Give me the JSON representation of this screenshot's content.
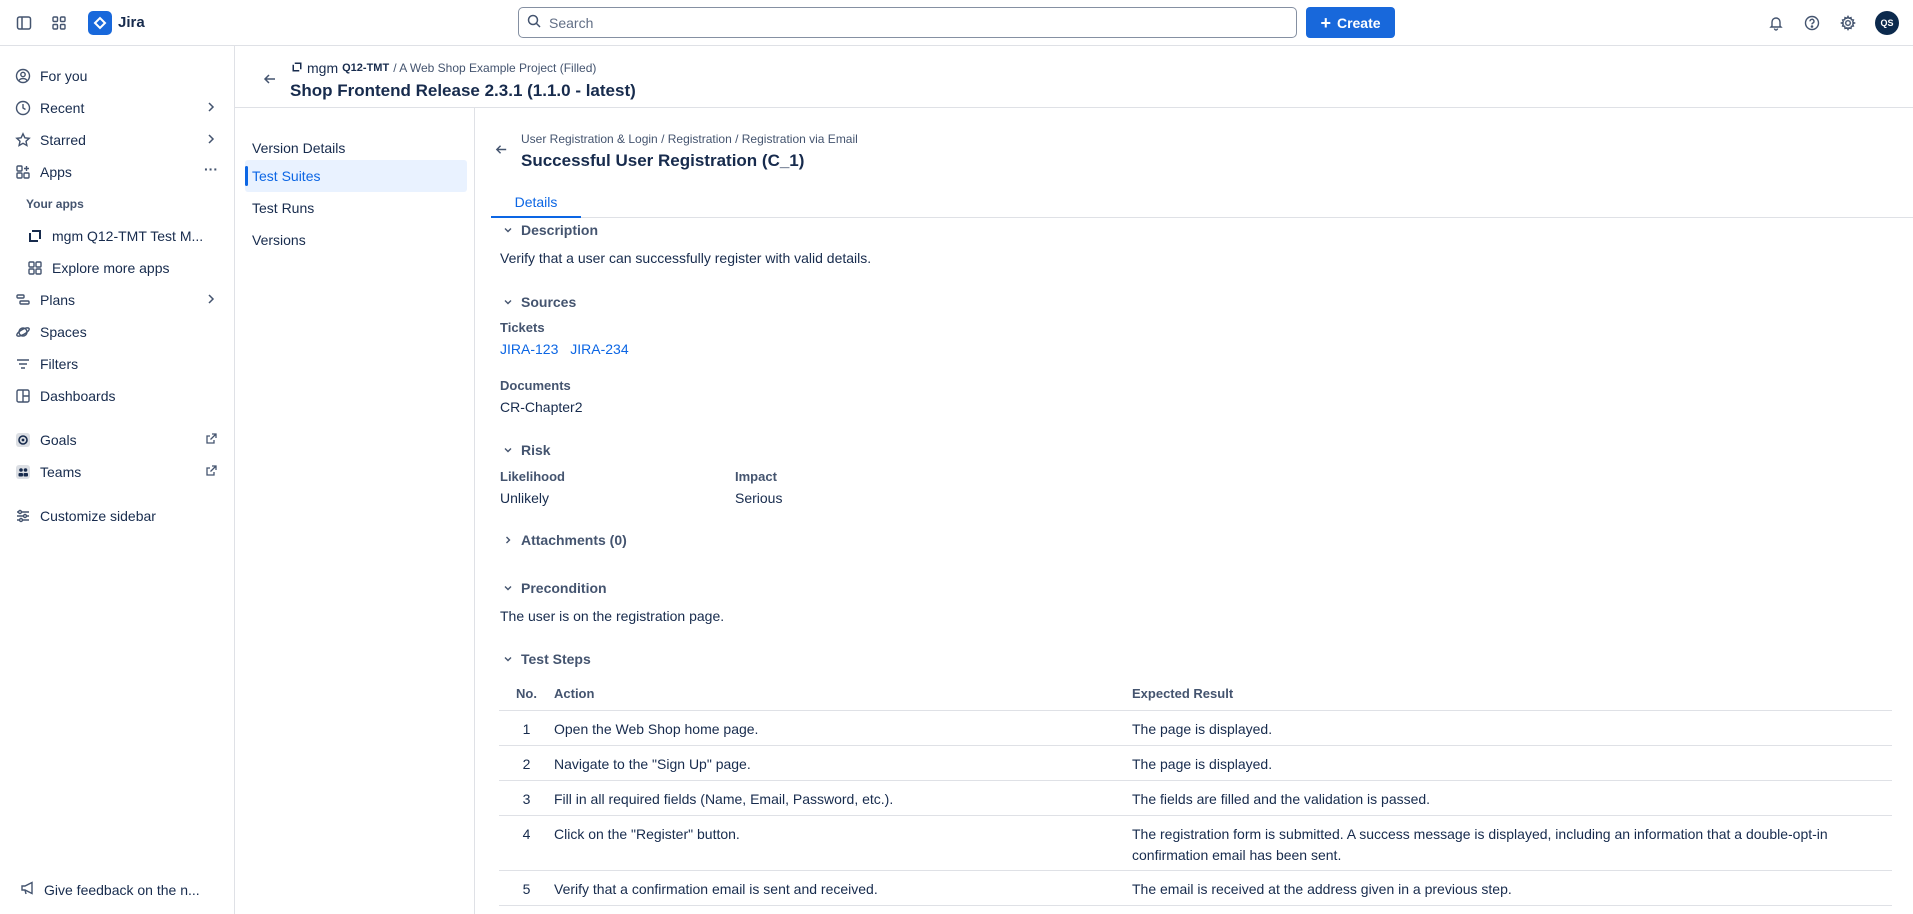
{
  "topbar": {
    "app_name": "Jira",
    "search_placeholder": "Search",
    "create_label": "Create",
    "avatar_initials": "QS"
  },
  "sidebar": {
    "items": [
      {
        "label": "For you",
        "icon": "user-circle-icon"
      },
      {
        "label": "Recent",
        "icon": "clock-icon"
      },
      {
        "label": "Starred",
        "icon": "star-icon"
      },
      {
        "label": "Apps",
        "icon": "apps-icon"
      }
    ],
    "your_apps_label": "Your apps",
    "app_items": [
      {
        "label": "mgm Q12-TMT Test M...",
        "icon": "app-logo-icon"
      },
      {
        "label": "Explore more apps",
        "icon": "apps-grid-icon"
      }
    ],
    "items2": [
      {
        "label": "Plans",
        "icon": "plans-icon"
      },
      {
        "label": "Spaces",
        "icon": "planet-icon"
      },
      {
        "label": "Filters",
        "icon": "filter-icon"
      },
      {
        "label": "Dashboards",
        "icon": "dashboard-icon"
      }
    ],
    "goals_label": "Goals",
    "teams_label": "Teams",
    "customize_label": "Customize sidebar",
    "feedback_label": "Give feedback on the n..."
  },
  "project": {
    "vendor": "mgm",
    "key": "Q12-TMT",
    "crumb_rest": "/ A Web Shop Example Project (Filled)",
    "title": "Shop Frontend Release 2.3.1 (1.1.0 - latest)"
  },
  "subnav": {
    "items": [
      "Version Details",
      "Test Suites",
      "Test Runs",
      "Versions"
    ]
  },
  "testcase": {
    "breadcrumb": "User Registration & Login / Registration / Registration via Email",
    "title": "Successful User Registration (C_1)",
    "tab": "Details",
    "description_head": "Description",
    "description": "Verify that a user can successfully register with valid details.",
    "sources_head": "Sources",
    "tickets_label": "Tickets",
    "tickets": [
      "JIRA-123",
      "JIRA-234"
    ],
    "documents_label": "Documents",
    "documents": "CR-Chapter2",
    "risk_head": "Risk",
    "likelihood_label": "Likelihood",
    "likelihood": "Unlikely",
    "impact_label": "Impact",
    "impact": "Serious",
    "attachments_head": "Attachments (0)",
    "precondition_head": "Precondition",
    "precondition": "The user is on the registration page.",
    "steps_head": "Test Steps",
    "steps_columns": [
      "No.",
      "Action",
      "Expected Result"
    ],
    "steps": [
      {
        "no": "1",
        "action": "Open the Web Shop home page.",
        "expected": "The page is displayed."
      },
      {
        "no": "2",
        "action": "Navigate to the \"Sign Up\" page.",
        "expected": "The page is displayed."
      },
      {
        "no": "3",
        "action": "Fill in all required fields (Name, Email, Password, etc.).",
        "expected": "The fields are filled and the validation is passed."
      },
      {
        "no": "4",
        "action": "Click on the \"Register\" button.",
        "expected": "The registration form is submitted. A success message is displayed, including an information that a double-opt-in confirmation email has been sent."
      },
      {
        "no": "5",
        "action": "Verify that a confirmation email is sent and received.",
        "expected": "The email is received at the address given in a previous step."
      }
    ]
  }
}
